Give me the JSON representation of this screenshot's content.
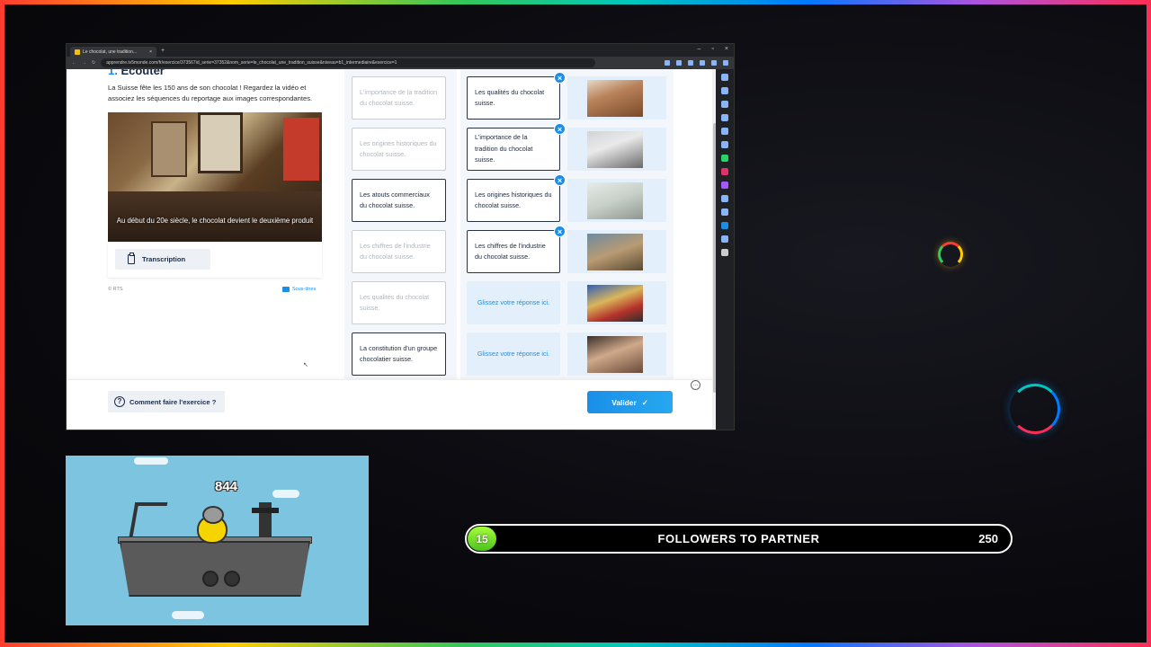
{
  "browser": {
    "tab_title": "Le chocolat, une tradition...",
    "tab_close": "×",
    "new_tab": "+",
    "window_controls": [
      "–",
      "▫",
      "×"
    ],
    "url": "apprendre.tv5monde.com/fr/exercice/373567id_serie=37352&nom_serie=le_chocolat_une_tradition_suisse&niveau=b1_intermediaire&exercice=1"
  },
  "exercise": {
    "number": "1.",
    "title": "Écouter",
    "intro": "La Suisse fête les 150 ans de son chocolat ! Regardez la vidéo et associez les séquences du reportage aux images correspondantes.",
    "video_caption": "Au début du 20e siècle, le chocolat devient le deuxième produit",
    "transcription_label": "Transcription",
    "credit": "© RTS",
    "subtitles_label": "Sous-titres"
  },
  "choices": [
    {
      "label": "L'importance de la tradition du chocolat suisse.",
      "state": "used"
    },
    {
      "label": "Les origines historiques du chocolat suisse.",
      "state": "used"
    },
    {
      "label": "Les atouts commerciaux du chocolat suisse.",
      "state": "available"
    },
    {
      "label": "Les chiffres de l'industrie du chocolat suisse.",
      "state": "used"
    },
    {
      "label": "Les qualités du chocolat suisse.",
      "state": "used"
    },
    {
      "label": "La constitution d'un groupe chocolatier suisse.",
      "state": "available"
    }
  ],
  "slots": [
    {
      "answer": "Les qualités du chocolat suisse.",
      "remove": "×",
      "image": "chocolate-heart"
    },
    {
      "answer": "L'importance de la tradition du chocolat suisse.",
      "remove": "×",
      "image": "chef-portrait"
    },
    {
      "answer": "Les origines historiques du chocolat suisse.",
      "remove": "×",
      "image": "factory-interior"
    },
    {
      "answer": "Les chiffres de l'industrie du chocolat suisse.",
      "remove": "×",
      "image": "cows-field"
    },
    {
      "answer": "Glissez votre réponse ici.",
      "remove": "",
      "image": "chocolate-packages"
    },
    {
      "answer": "Glissez votre réponse ici.",
      "remove": "",
      "image": "woman-interview"
    }
  ],
  "footer": {
    "help_icon": "?",
    "help_label": "Comment faire l'exercice ?",
    "submit_label": "Valider",
    "submit_icon": "✓"
  },
  "game": {
    "score": "844"
  },
  "followers": {
    "current": "15",
    "label": "FOLLOWERS TO PARTNER",
    "goal": "250"
  },
  "colors": {
    "accent": "#1b8ee8",
    "dark_text": "#1a2b4a",
    "slot_bg": "#e3f0fb",
    "badge_green": "#4cc21d"
  }
}
